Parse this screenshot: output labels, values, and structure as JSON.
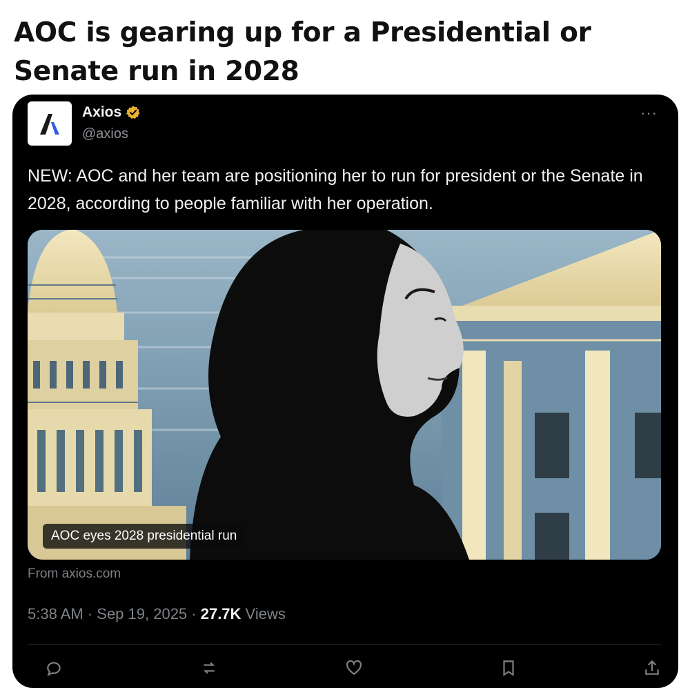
{
  "headline": "AOC is gearing up for a Presidential or Senate run in 2028",
  "post": {
    "author": {
      "name": "Axios",
      "handle": "@axios",
      "verified": true,
      "logo_letter": "Λ"
    },
    "more_menu": "···",
    "text": "NEW: AOC and her team are positioning her to run for president or the Senate in 2028, according to people familiar with her operation.",
    "media": {
      "caption": "AOC eyes 2028 presidential run"
    },
    "source": "From axios.com",
    "timestamp": "5:38 AM · Sep 19, 2025 · ",
    "views_count": "27.7K",
    "views_label": " Views"
  },
  "colors": {
    "background": "#ffffff",
    "card": "#000000",
    "text_primary": "#f2f2f2",
    "text_secondary": "#7d8287",
    "verified_badge": "#e8b130",
    "axios_blue": "#2f5bea"
  }
}
